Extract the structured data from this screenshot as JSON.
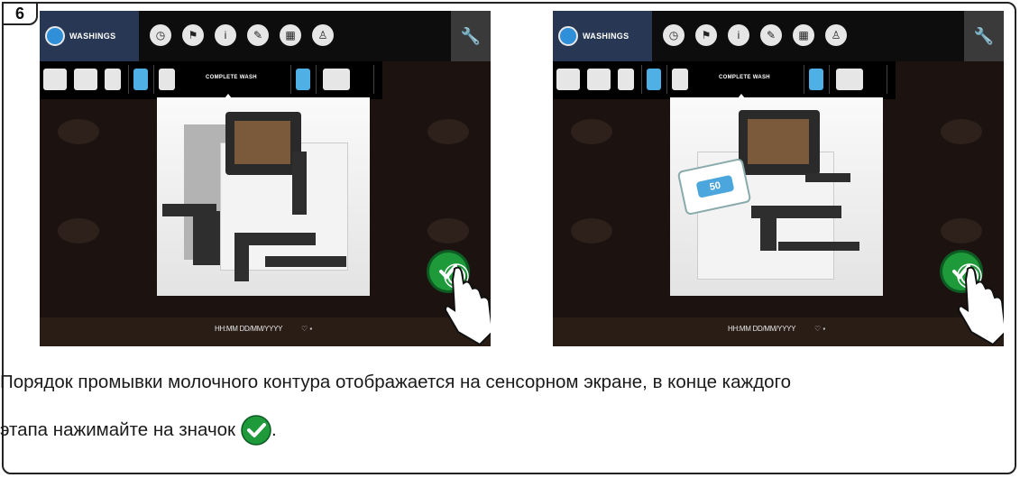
{
  "step_number": "6",
  "screens": [
    {
      "tab_label": "WASHINGS",
      "subtab_label": "COMPLETE WASH",
      "status_time": "HH:MM DD/MM/YYYY",
      "status_icons": "♡  ▪"
    },
    {
      "tab_label": "WASHINGS",
      "subtab_label": "COMPLETE WASH",
      "status_time": "HH:MM DD/MM/YYYY",
      "status_icons": "♡  ▪",
      "cleaner_label": "50"
    }
  ],
  "caption": {
    "line1": "Порядок промывки молочного контура отображается на сенсорном экране, в конце каждого",
    "line2": "этапа нажимайте на значок",
    "line2_end": "."
  },
  "icons": {
    "confirm": "check-circle-icon",
    "settings": "wrench-icon",
    "touch": "hand-pointer-icon"
  },
  "colors": {
    "confirm_green": "#1e9a3a",
    "tab_blue": "#283854",
    "drop_blue": "#2f8fd8"
  }
}
